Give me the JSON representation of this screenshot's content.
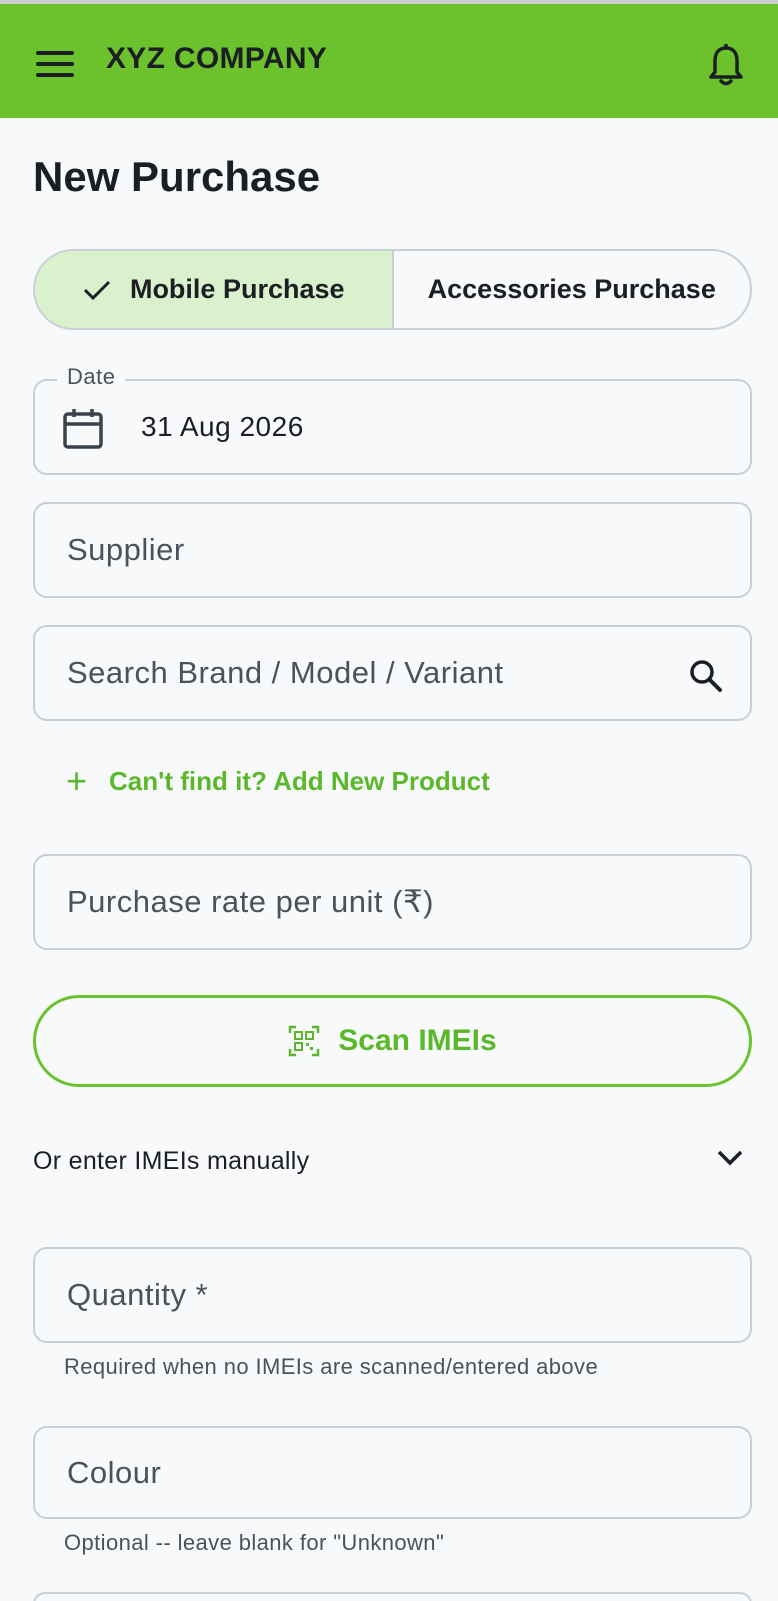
{
  "app": {
    "title": "XYZ COMPANY"
  },
  "page": {
    "title": "New Purchase"
  },
  "tabs": [
    {
      "label": "Mobile Purchase",
      "selected": true
    },
    {
      "label": "Accessories Purchase",
      "selected": false
    }
  ],
  "form": {
    "date": {
      "label": "Date",
      "value": "31 Aug 2026"
    },
    "supplier": {
      "placeholder": "Supplier"
    },
    "search": {
      "placeholder": "Search Brand / Model / Variant"
    },
    "add_product_label": "Can't find it? Add New Product",
    "rate": {
      "placeholder": "Purchase rate per unit (₹)"
    },
    "scan_label": "Scan IMEIs",
    "manual_label": "Or enter IMEIs manually",
    "quantity": {
      "placeholder": "Quantity *",
      "helper": "Required when no IMEIs are scanned/entered above"
    },
    "colour": {
      "placeholder": "Colour",
      "helper": "Optional -- leave blank for \"Unknown\""
    }
  },
  "colors": {
    "accent": "#6cc22c",
    "accent_text": "#5bb82a",
    "selected_tab_bg": "#d9f1cc"
  },
  "icons": [
    "menu-icon",
    "bell-icon",
    "check-icon",
    "calendar-icon",
    "search-icon",
    "plus-icon",
    "qr-scan-icon",
    "chevron-down-icon"
  ]
}
